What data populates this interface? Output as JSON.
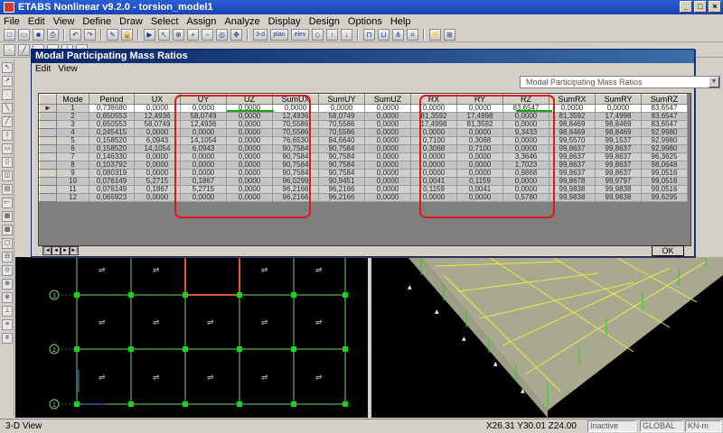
{
  "app": {
    "title": "ETABS Nonlinear v9.2.0 - torsion_model1"
  },
  "menu": [
    "File",
    "Edit",
    "View",
    "Define",
    "Draw",
    "Select",
    "Assign",
    "Analyze",
    "Display",
    "Design",
    "Options",
    "Help"
  ],
  "toolbar": {
    "view_3d": "3-d",
    "view_plan": "plan",
    "view_elev": "elev"
  },
  "dialog": {
    "title": "Modal Participating Mass Ratios",
    "menu": [
      "Edit",
      "View"
    ],
    "table_select": "Modal Participating Mass Ratios",
    "ok_label": "OK",
    "columns": [
      "Mode",
      "Period",
      "UX",
      "UY",
      "UZ",
      "SumUX",
      "SumUY",
      "SumUZ",
      "RX",
      "RY",
      "RZ",
      "SumRX",
      "SumRY",
      "SumRZ"
    ],
    "rows": [
      [
        "1",
        "0,738680",
        "0,0000",
        "0,0000",
        "0,0000",
        "0,0000",
        "0,0000",
        "0,0000",
        "0,0000",
        "0,0000",
        "83,6547",
        "0,0000",
        "0,0000",
        "83,6547"
      ],
      [
        "2",
        "0,650553",
        "12,4936",
        "58,0749",
        "0,0000",
        "12,4936",
        "58,0749",
        "0,0000",
        "81,3592",
        "17,4998",
        "0,0000",
        "81,3592",
        "17,4998",
        "83,6547"
      ],
      [
        "3",
        "0,650553",
        "58,0749",
        "12,4936",
        "0,0000",
        "70,5586",
        "70,5586",
        "0,0000",
        "17,4998",
        "81,3592",
        "0,0000",
        "98,8469",
        "98,8469",
        "83,6547"
      ],
      [
        "4",
        "0,245415",
        "0,0000",
        "0,0000",
        "0,0000",
        "70,5586",
        "70,5586",
        "0,0000",
        "0,0000",
        "0,0000",
        "9,3433",
        "98,8469",
        "98,8469",
        "92,9980"
      ],
      [
        "5",
        "0,158520",
        "6,0943",
        "14,1054",
        "0,0000",
        "76,6530",
        "84,6640",
        "0,0000",
        "0,7100",
        "0,3068",
        "0,0000",
        "99,5570",
        "99,1537",
        "92,9980"
      ],
      [
        "6",
        "0,158520",
        "14,1054",
        "6,0943",
        "0,0000",
        "90,7584",
        "90,7584",
        "0,0000",
        "0,3068",
        "0,7100",
        "0,0000",
        "99,8637",
        "99,8637",
        "92,9980"
      ],
      [
        "7",
        "0,146330",
        "0,0000",
        "0,0000",
        "0,0000",
        "90,7584",
        "90,7584",
        "0,0000",
        "0,0000",
        "0,0000",
        "3,3646",
        "99,8637",
        "99,8637",
        "96,3625"
      ],
      [
        "8",
        "0,103792",
        "0,0000",
        "0,0000",
        "0,0000",
        "90,7584",
        "90,7584",
        "0,0000",
        "0,0000",
        "0,0000",
        "1,7023",
        "99,8637",
        "99,8637",
        "98,0648"
      ],
      [
        "9",
        "0,080319",
        "0,0000",
        "0,0000",
        "0,0000",
        "90,7584",
        "90,7584",
        "0,0000",
        "0,0000",
        "0,0000",
        "0,9868",
        "99,8637",
        "99,8637",
        "99,0516"
      ],
      [
        "10",
        "0,076149",
        "5,2715",
        "0,1867",
        "0,0000",
        "96,0299",
        "90,9451",
        "0,0000",
        "0,0041",
        "0,1159",
        "0,0000",
        "99,8678",
        "99,9797",
        "99,0516"
      ],
      [
        "11",
        "0,076149",
        "0,1867",
        "5,2715",
        "0,0000",
        "96,2166",
        "96,2166",
        "0,0000",
        "0,1159",
        "0,0041",
        "0,0000",
        "99,9838",
        "99,9838",
        "99,0516"
      ],
      [
        "12",
        "0,065923",
        "0,0000",
        "0,0000",
        "0,0000",
        "96,2166",
        "96,2166",
        "0,0000",
        "0,0000",
        "0,0000",
        "0,5780",
        "99,9838",
        "99,9838",
        "99,6295"
      ]
    ]
  },
  "left_view": {
    "grid_labels": [
      "3",
      "2",
      "1"
    ]
  },
  "status": {
    "view_name": "3-D View",
    "coords": "X26.31  Y30.01  Z24.00",
    "state": "Inactive",
    "coord_sys": "GLOBAL",
    "units": "KN-m"
  }
}
